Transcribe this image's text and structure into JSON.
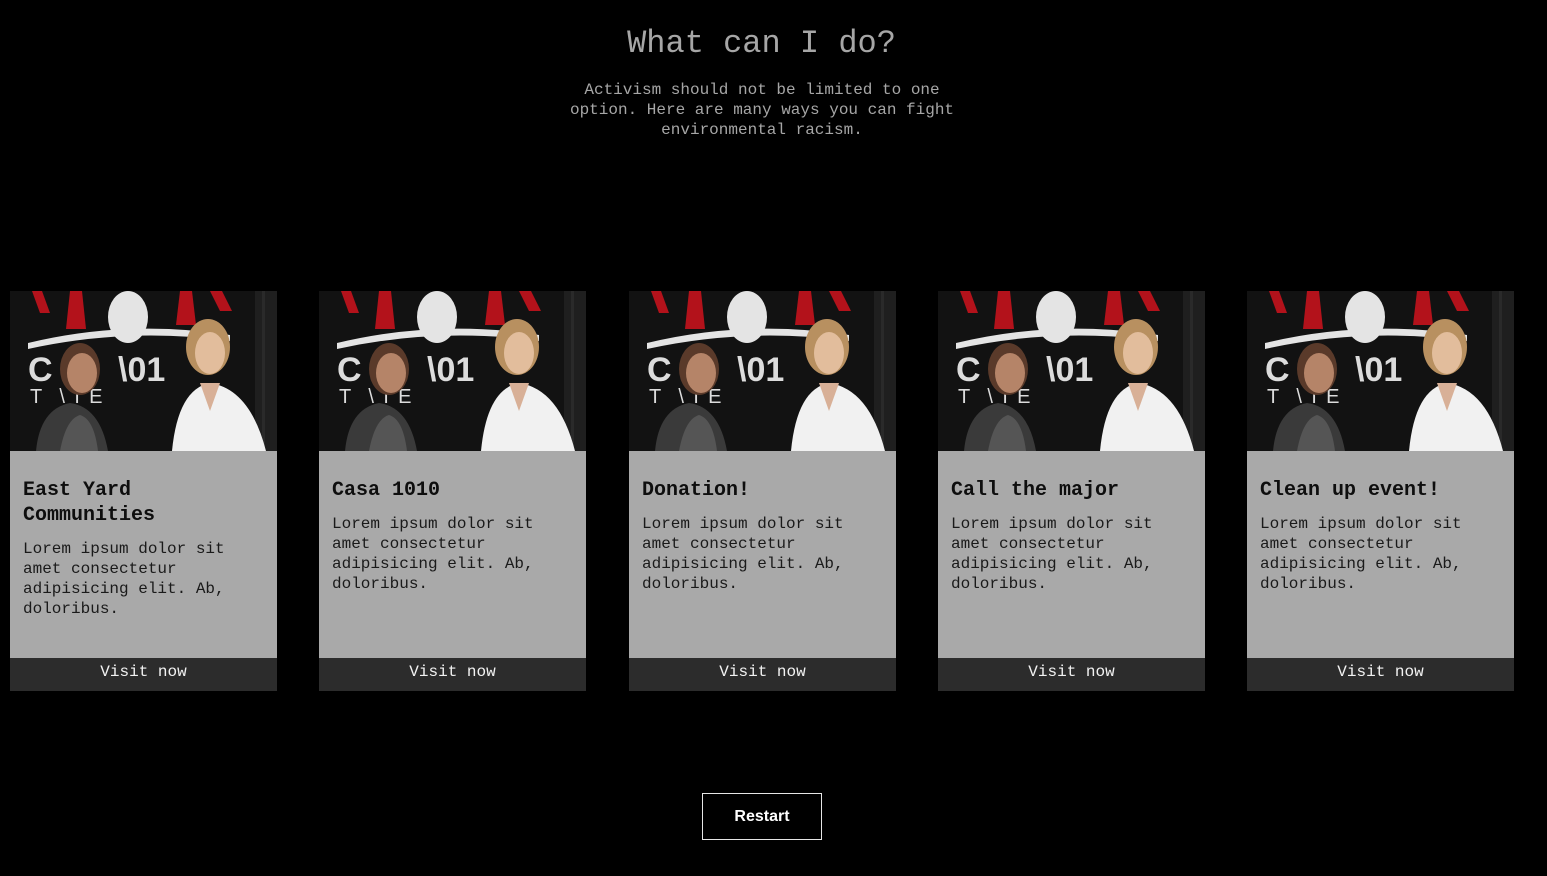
{
  "header": {
    "title": "What can I do?",
    "subtitle": "Activism should not be limited to one option. Here are many ways you can fight environmental racism."
  },
  "cards": [
    {
      "title": "East Yard Communities",
      "text": "Lorem ipsum dolor sit amet consectetur adipisicing elit. Ab, doloribus.",
      "button_label": "Visit now",
      "image_icon": "photo-two-women-casa-1010-theatre"
    },
    {
      "title": "Casa 1010",
      "text": "Lorem ipsum dolor sit amet consectetur adipisicing elit. Ab, doloribus.",
      "button_label": "Visit now",
      "image_icon": "photo-two-women-casa-1010-theatre"
    },
    {
      "title": "Donation!",
      "text": "Lorem ipsum dolor sit amet consectetur adipisicing elit. Ab, doloribus.",
      "button_label": "Visit now",
      "image_icon": "photo-two-women-casa-1010-theatre"
    },
    {
      "title": "Call the major",
      "text": "Lorem ipsum dolor sit amet consectetur adipisicing elit. Ab, doloribus.",
      "button_label": "Visit now",
      "image_icon": "photo-two-women-casa-1010-theatre"
    },
    {
      "title": "Clean up event!",
      "text": "Lorem ipsum dolor sit amet consectetur adipisicing elit. Ab, doloribus.",
      "button_label": "Visit now",
      "image_icon": "photo-two-women-casa-1010-theatre"
    }
  ],
  "restart": {
    "label": "Restart"
  },
  "colors": {
    "background": "#000000",
    "heading": "#a6a6a6",
    "card": "#a9a9a9",
    "card_button": "#2c2c2c",
    "accent_red": "#b3121b"
  }
}
